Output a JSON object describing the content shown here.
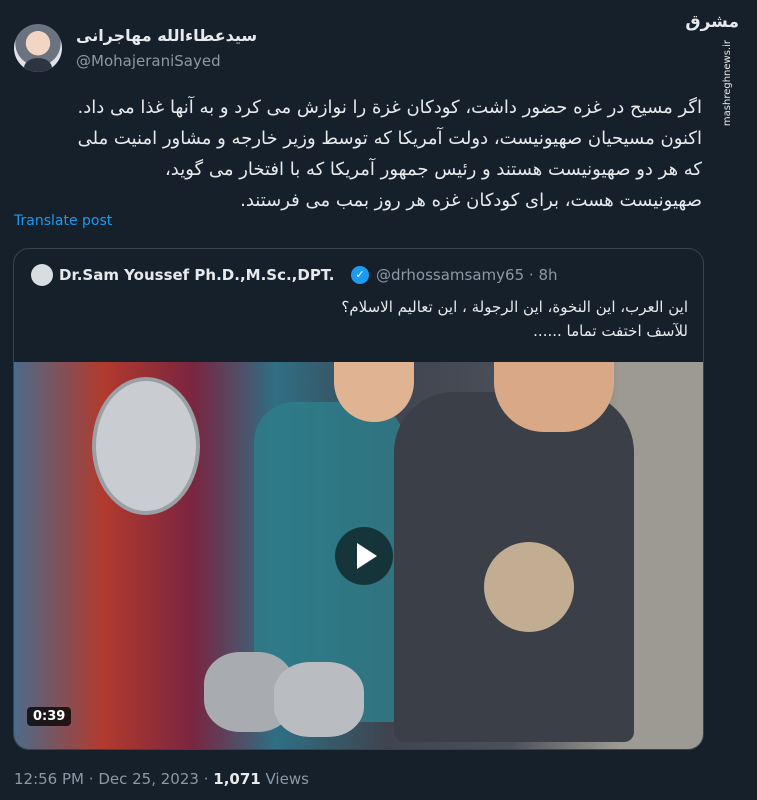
{
  "tweet": {
    "author_name": "سیدعطاءالله مهاجرانی",
    "author_handle": "@MohajeraniSayed",
    "text_lines": [
      "اگر مسیح در غزه حضور داشت، کودکان غزة را نوازش می کرد و به آنها غذا می داد.",
      "اکنون مسیحیان صهیونیست، دولت آمریکا که توسط وزیر خارجه و مشاور امنیت ملی",
      "که هر دو صهیونیست هستند  و رئیس جمهور آمریکا که با افتخار می گوید،",
      "صهیونیست هست، برای کودکان غزه هر روز بمب می فرستند."
    ],
    "translate_label": "Translate post",
    "time": "12:56 PM",
    "date": "Dec 25, 2023",
    "views_count": "1,071",
    "views_label": "Views",
    "separator": "·"
  },
  "quote": {
    "name": "Dr.Sam Youssef Ph.D.,M.Sc.,DPT.",
    "handle": "@drhossamsamy65",
    "time": "8h",
    "separator": "·",
    "text_lines": [
      "اين العرب، اين النخوة، اين الرجولة ، اين تعاليم الاسلام؟",
      "للآسف اختفت تماما ......"
    ],
    "video_duration": "0:39"
  },
  "watermark": {
    "logo": "مشرق",
    "url": "mashreghnews.ir"
  },
  "icons": {
    "verified": "verified-badge-icon",
    "play": "play-icon"
  },
  "colors": {
    "background": "#15202b",
    "link": "#1d9bf0",
    "muted": "#8b98a5"
  }
}
